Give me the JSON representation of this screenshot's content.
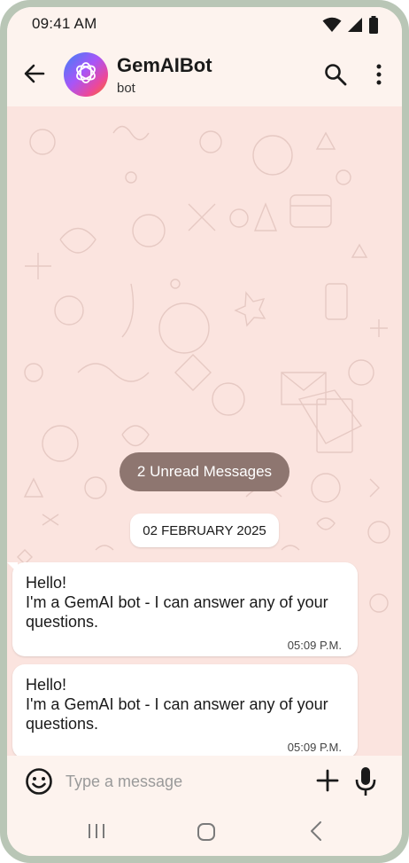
{
  "status_bar": {
    "time": "09:41 AM",
    "icons": [
      "wifi-icon",
      "signal-icon",
      "battery-icon"
    ]
  },
  "header": {
    "name": "GemAIBot",
    "subtitle": "bot",
    "icons": [
      "back-arrow-icon",
      "bot-logo-icon",
      "search-icon",
      "more-vert-icon"
    ]
  },
  "chat": {
    "unread_label": "2 Unread Messages",
    "date_label": "02 FEBRUARY 2025",
    "messages": [
      {
        "text": "Hello!\nI'm a GemAI bot - I can answer any of your questions.",
        "time": "05:09 P.M."
      },
      {
        "text": "Hello!\nI'm a GemAI bot - I can answer any of your questions.",
        "time": "05:09 P.M."
      }
    ]
  },
  "input_bar": {
    "placeholder": "Type a message",
    "value": "",
    "icons": [
      "emoji-icon",
      "plus-icon",
      "mic-icon"
    ]
  },
  "nav_bar": {
    "icons": [
      "recent-apps-icon",
      "home-icon",
      "nav-back-icon"
    ]
  },
  "colors": {
    "frame": "#b9c6b6",
    "header_bg": "#fdf3ee",
    "chat_bg": "#fbe4df",
    "unread_pill": "#8e7670",
    "bubble": "#ffffff"
  }
}
